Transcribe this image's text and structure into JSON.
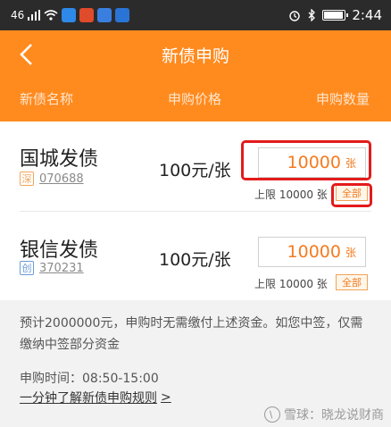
{
  "status_bar": {
    "signal_text": "46",
    "time": "2:44",
    "app_icon_colors": [
      "#2e89e8",
      "#e04b2b",
      "#3a7fe0",
      "#2a74d6"
    ],
    "battery_fill": 0.85
  },
  "header": {
    "back_symbol": "<",
    "title": "新债申购",
    "col_name": "新债名称",
    "col_price": "申购价格",
    "col_qty": "申购数量",
    "bg_color": "#ff8a1e"
  },
  "bonds": [
    {
      "name": "国城发债",
      "market_tag": "深",
      "code": "070688",
      "price": "100元/张",
      "qty_value": "10000",
      "qty_unit": "张",
      "limit_text": "上限 10000 张",
      "all_label": "全部"
    },
    {
      "name": "银信发债",
      "market_tag": "创",
      "code": "370231",
      "price": "100元/张",
      "qty_value": "10000",
      "qty_unit": "张",
      "limit_text": "上限 10000 张",
      "all_label": "全部"
    }
  ],
  "notice": "预计2000000元，申购时无需缴付上述资金。如您中签，仅需缴纳中签部分资金",
  "time_info": "申购时间：08:50-15:00",
  "rules_link": "一分钟了解新债申购规则",
  "rules_arrow": ">",
  "watermark": "雪球：晓龙说财商",
  "accent_color": "#f47b20",
  "highlight_color": "#e31b1b"
}
